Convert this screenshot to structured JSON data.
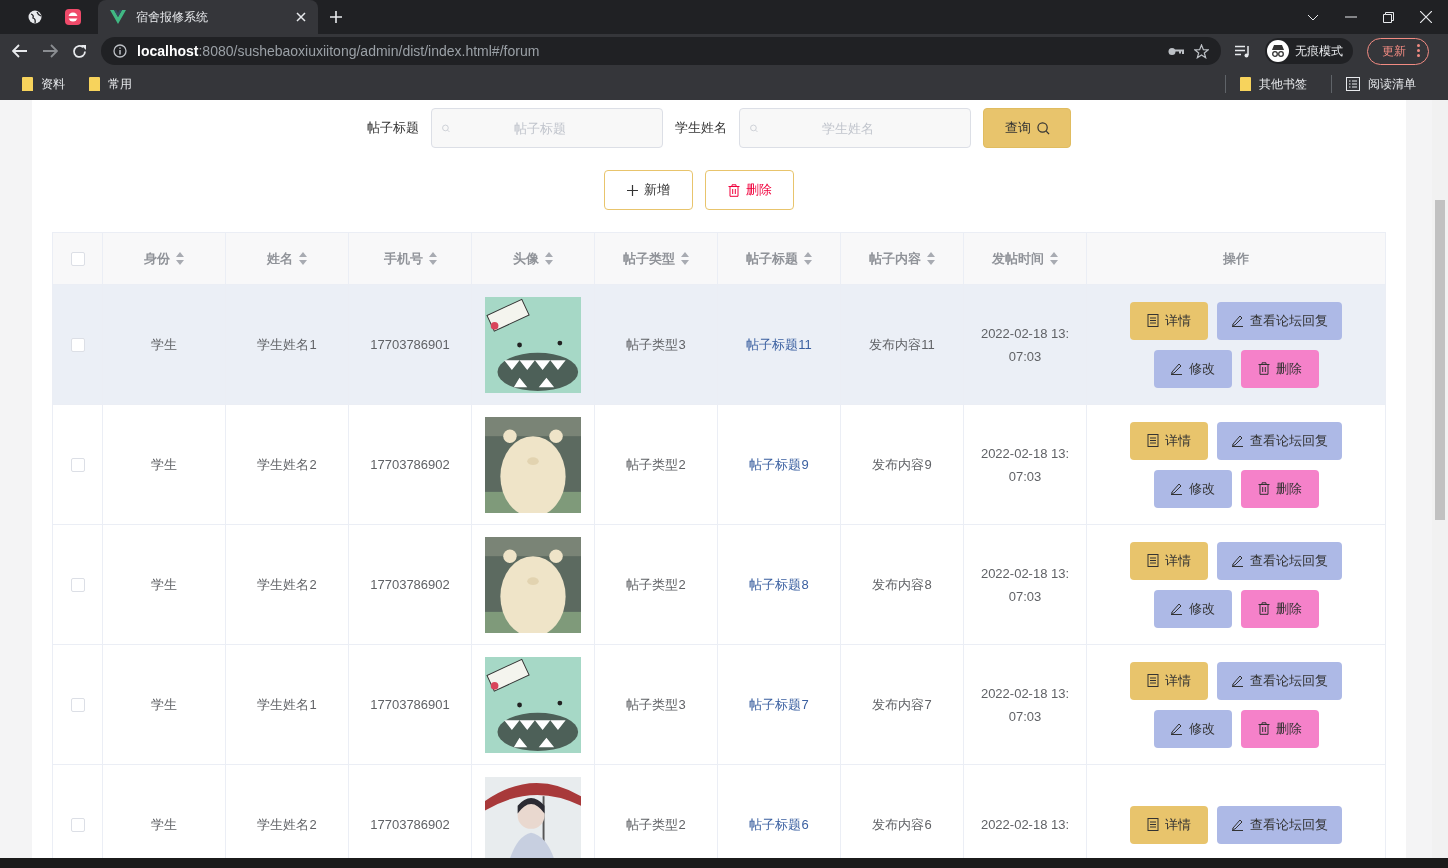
{
  "browser": {
    "tabs": [
      {
        "kind": "globe",
        "selected": false
      },
      {
        "kind": "app",
        "selected": false
      },
      {
        "kind": "page",
        "title": "宿舍报修系统",
        "selected": true
      }
    ],
    "address": {
      "host": "localhost",
      "rest": ":8080/sushebaoxiuxiitong/admin/dist/index.html#/forum"
    },
    "profile": "无痕模式",
    "update_button": "更新",
    "bookmarks": [
      "资料",
      "常用"
    ],
    "bookmarks_right": [
      "其他书签"
    ],
    "reading_list": "阅读清单"
  },
  "search": {
    "fields": [
      {
        "label": "帖子标题",
        "placeholder": "帖子标题"
      },
      {
        "label": "学生姓名",
        "placeholder": "学生姓名"
      }
    ],
    "button": "查询"
  },
  "actions": [
    {
      "kind": "add",
      "label": "新增"
    },
    {
      "kind": "delete",
      "label": "删除"
    }
  ],
  "table": {
    "select_all_checked": false,
    "columns": [
      {
        "label": "身份",
        "sortable": true
      },
      {
        "label": "姓名",
        "sortable": true
      },
      {
        "label": "手机号",
        "sortable": true
      },
      {
        "label": "头像",
        "sortable": true
      },
      {
        "label": "帖子类型",
        "sortable": true
      },
      {
        "label": "帖子标题",
        "sortable": true
      },
      {
        "label": "帖子内容",
        "sortable": true
      },
      {
        "label": "发帖时间",
        "sortable": true
      },
      {
        "label": "操作",
        "sortable": false
      }
    ],
    "rows": [
      {
        "checked": false,
        "hovered": true,
        "identity": "学生",
        "name": "学生姓名1",
        "phone": "17703786901",
        "avatar": {
          "kind": "picture"
        },
        "type": "帖子类型3",
        "title": "帖子标题11",
        "content": "发布内容11",
        "time": "2022-02-18 13:07:03",
        "buttons": [
          {
            "kind": "detail",
            "label": "详情"
          },
          {
            "kind": "reply",
            "label": "查看论坛回复"
          },
          {
            "kind": "edit",
            "label": "修改"
          },
          {
            "kind": "delete",
            "label": "删除"
          }
        ]
      },
      {
        "checked": false,
        "hovered": false,
        "identity": "学生",
        "name": "学生姓名2",
        "phone": "17703786902",
        "avatar": {
          "kind": "picture"
        },
        "type": "帖子类型2",
        "title": "帖子标题9",
        "content": "发布内容9",
        "time": "2022-02-18 13:07:03",
        "buttons": [
          {
            "kind": "detail",
            "label": "详情"
          },
          {
            "kind": "reply",
            "label": "查看论坛回复"
          },
          {
            "kind": "edit",
            "label": "修改"
          },
          {
            "kind": "delete",
            "label": "删除"
          }
        ]
      },
      {
        "checked": false,
        "hovered": false,
        "identity": "学生",
        "name": "学生姓名2",
        "phone": "17703786902",
        "avatar": {
          "kind": "picture"
        },
        "type": "帖子类型2",
        "title": "帖子标题8",
        "content": "发布内容8",
        "time": "2022-02-18 13:07:03",
        "buttons": [
          {
            "kind": "detail",
            "label": "详情"
          },
          {
            "kind": "reply",
            "label": "查看论坛回复"
          },
          {
            "kind": "edit",
            "label": "修改"
          },
          {
            "kind": "delete",
            "label": "删除"
          }
        ]
      },
      {
        "checked": false,
        "hovered": false,
        "identity": "学生",
        "name": "学生姓名1",
        "phone": "17703786901",
        "avatar": {
          "kind": "picture"
        },
        "type": "帖子类型3",
        "title": "帖子标题7",
        "content": "发布内容7",
        "time": "2022-02-18 13:07:03",
        "buttons": [
          {
            "kind": "detail",
            "label": "详情"
          },
          {
            "kind": "reply",
            "label": "查看论坛回复"
          },
          {
            "kind": "edit",
            "label": "修改"
          },
          {
            "kind": "delete",
            "label": "删除"
          }
        ]
      },
      {
        "checked": false,
        "hovered": false,
        "identity": "学生",
        "name": "学生姓名2",
        "phone": "17703786902",
        "avatar": {
          "kind": "picture"
        },
        "type": "帖子类型2",
        "title": "帖子标题6",
        "content": "发布内容6",
        "time": "2022-02-18 13:",
        "buttons": [
          {
            "kind": "detail",
            "label": "详情"
          },
          {
            "kind": "reply",
            "label": "查看论坛回复"
          }
        ]
      }
    ]
  }
}
